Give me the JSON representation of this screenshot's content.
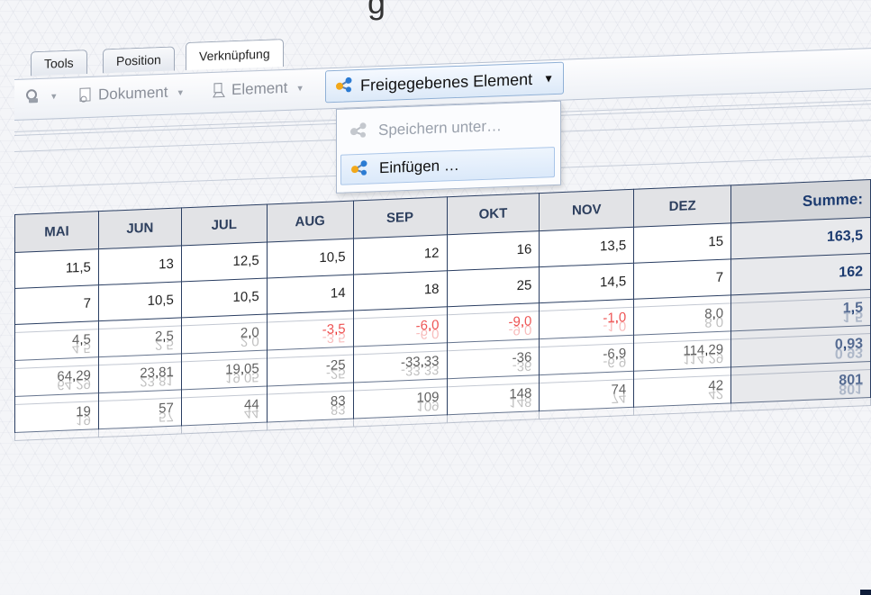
{
  "top_glyph": "g",
  "tabs": [
    "Tools",
    "Position",
    "Verknüpfung"
  ],
  "toolbar": {
    "document_label": "Dokument",
    "element_label": "Element",
    "shared_label": "Freigegebenes Element"
  },
  "menu": {
    "items": [
      {
        "label": "Speichern unter…",
        "enabled": false
      },
      {
        "label": "Einfügen …",
        "enabled": true
      }
    ]
  },
  "table": {
    "headers": [
      "MAI",
      "JUN",
      "JUL",
      "AUG",
      "SEP",
      "OKT",
      "NOV",
      "DEZ",
      "Summe:"
    ],
    "rows": [
      [
        "11,5",
        "13",
        "12,5",
        "10,5",
        "12",
        "16",
        "13,5",
        "15",
        "163,5"
      ],
      [
        "7",
        "10,5",
        "10,5",
        "14",
        "18",
        "25",
        "14,5",
        "7",
        "162"
      ],
      [
        "4,5",
        "2,5",
        "2,0",
        "-3,5",
        "-6,0",
        "-9,0",
        "-1,0",
        "8,0",
        "1,5"
      ],
      [
        "64,29",
        "23,81",
        "19,05",
        "-25",
        "-33,33",
        "-36",
        "-6,9",
        "114,29",
        "0,93"
      ],
      [
        "19",
        "57",
        "44",
        "83",
        "109",
        "148",
        "74",
        "42",
        "801"
      ]
    ],
    "negative_cells": [
      [
        2,
        3
      ],
      [
        2,
        4
      ],
      [
        2,
        5
      ],
      [
        2,
        6
      ]
    ],
    "negative_color": "#e81212"
  }
}
